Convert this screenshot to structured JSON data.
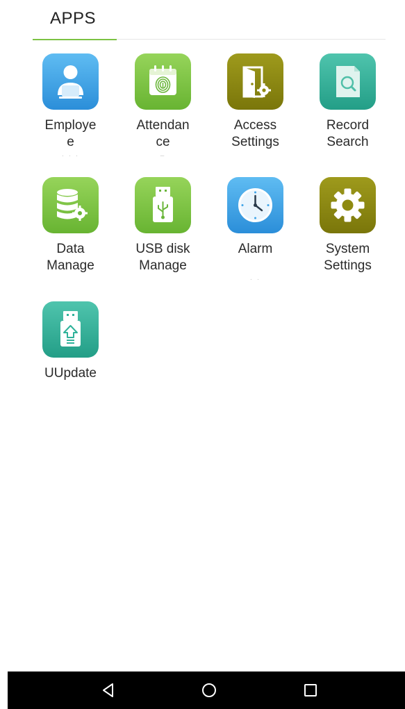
{
  "tabs": {
    "active_label": "APPS"
  },
  "apps": [
    {
      "label": "Employe\ne",
      "dots": "· · ·",
      "icon": "user-management-icon"
    },
    {
      "label": "Attendan\nce",
      "dots": "–",
      "icon": "fingerprint-calendar-icon"
    },
    {
      "label": "Access\nSettings",
      "dots": "",
      "icon": "door-gear-icon"
    },
    {
      "label": "Record\nSearch",
      "dots": "",
      "icon": "document-search-icon"
    },
    {
      "label": "Data\nManage",
      "dots": "",
      "icon": "database-gear-icon"
    },
    {
      "label": "USB disk\nManage",
      "dots": "",
      "icon": "usb-drive-icon"
    },
    {
      "label": "Alarm",
      "dots": "· ·",
      "icon": "clock-icon"
    },
    {
      "label": "System\nSettings",
      "dots": "",
      "icon": "gear-icon"
    },
    {
      "label": "UUpdate",
      "dots": "",
      "icon": "usb-upload-icon"
    }
  ],
  "nav": {
    "back_icon": "triangle-back-icon",
    "home_icon": "circle-home-icon",
    "recents_icon": "square-recents-icon"
  },
  "colors": {
    "tab_underline": "#7cc243",
    "blue": "#3ea4e8",
    "green": "#7cc243",
    "olive": "#8e8a10",
    "teal": "#2fb29a",
    "nav_bar": "#000000"
  }
}
